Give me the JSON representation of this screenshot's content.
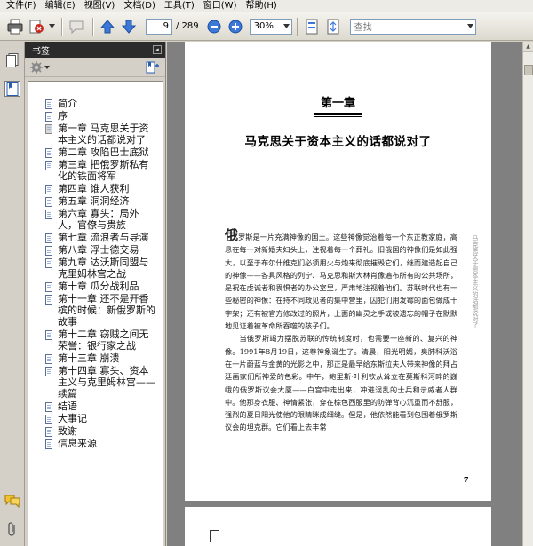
{
  "menu": {
    "items": [
      "文件(F)",
      "编辑(E)",
      "视图(V)",
      "文档(D)",
      "工具(T)",
      "窗口(W)",
      "帮助(H)"
    ]
  },
  "toolbar": {
    "current_page": "9",
    "total_pages": "/ 289",
    "zoom": "30%",
    "search_placeholder": "查找",
    "icons": [
      "print-icon",
      "create-pdf-icon",
      "comment-icon",
      "previous-page-icon",
      "next-page-icon",
      "zoom-out-icon",
      "zoom-in-icon",
      "page-layout-icon",
      "fit-page-icon"
    ]
  },
  "bookmarks_panel": {
    "title": "书签",
    "items": [
      {
        "label": "简介",
        "icon": "page"
      },
      {
        "label": "序",
        "icon": "page"
      },
      {
        "label": "第一章 马克思关于资本主义的话都说对了",
        "icon": "page-gray"
      },
      {
        "label": "第二章 攻陷巴士底狱",
        "icon": "page"
      },
      {
        "label": "第三章 把俄罗斯私有化的铁面将军",
        "icon": "page"
      },
      {
        "label": "第四章 谁人获利",
        "icon": "page"
      },
      {
        "label": "第五章 洞洞经济",
        "icon": "page"
      },
      {
        "label": "第六章 寡头：局外人，官僚与贵族",
        "icon": "page"
      },
      {
        "label": "第七章 流浪者与导演",
        "icon": "page"
      },
      {
        "label": "第八章 浮士德交易",
        "icon": "page"
      },
      {
        "label": "第九章 达沃斯同盟与克里姆林宫之战",
        "icon": "page"
      },
      {
        "label": "第十章 瓜分战利品",
        "icon": "page"
      },
      {
        "label": "第十一章 还不是开香槟的时候：新俄罗斯的故事",
        "icon": "page"
      },
      {
        "label": "第十二章 窃贼之间无荣誉：银行家之战",
        "icon": "page"
      },
      {
        "label": "第十三章 崩溃",
        "icon": "page"
      },
      {
        "label": "第十四章 寡头、资本主义与克里姆林宫——续篇",
        "icon": "page"
      },
      {
        "label": "结语",
        "icon": "page"
      },
      {
        "label": "大事记",
        "icon": "page"
      },
      {
        "label": "致谢",
        "icon": "page"
      },
      {
        "label": "信息来源",
        "icon": "page"
      }
    ]
  },
  "document": {
    "chapter_number": "第一章",
    "chapter_title": "马克思关于资本主义的话都说对了",
    "dropcap": "俄",
    "paragraph1": "罗斯是一片充满神像的国土。这些神像觉治着每一个东正教家庭，高悬在每一对新婚夫妇头上，注视着每一个葬礼。旧俄国的神像们是如此强大，以至于布尔什维克们必须用火与炮来彻底摧毁它们，继而建造起自己的神像——各具风格的列宁、马克思和斯大林肖像遍布所有的公共场所，是祝在虔诚者和畏惧者的办公室里，严肃地注视着他们。苏联时代也有一些秘密的神像：在持不同政见者的集中营里，囚犯们用发霉的面包做成十字架；还有被官方修改过的照片，上面的幽灵之手或被遗忘的帽子在默默地见证着被革命所吞噬的孩子们。",
    "paragraph2": "当俄罗斯竭力摆脱苏联的传统制度时，也需要一座新的、复兴的神像。1991年8月19日，这尊神象诞生了。清晨，阳光明媚，臭肺科沃浴在一片蔚蓝与金黄的光影之中，那正是最早给东斯拉夫人带来神像的拜占廷画家们所神爱的色彩。中午，鲍里斯·叶利钦从耸立在莫斯科河畔的巍峨的俄罗斯议会大厦——白宫中走出来，冲进混乱的士兵和示威者人群中。他那身衣服、神情紧张，穿在棕色西服里的防弹背心沉重而不舒服，强烈的夏日阳光使他的眼睛眯成细缝。但是，他依然能看到包围着俄罗斯议会的坦克群。它们看上去丰常",
    "side_note": "马克思关于资本主义的话都说对了",
    "page_number": "7"
  },
  "colors": {
    "panel_header_bg": "#2b2b2b",
    "doc_background": "#808080",
    "toolbar_bg": "#dcd9cf"
  }
}
